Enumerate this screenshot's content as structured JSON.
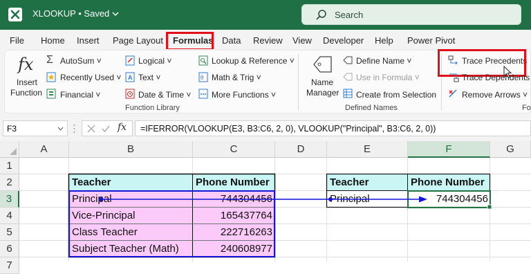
{
  "titlebar": {
    "doc_name": "XLOOKUP",
    "saved": "• Saved ",
    "search_placeholder": "Search"
  },
  "menu": {
    "file": "File",
    "home": "Home",
    "insert": "Insert",
    "page_layout": "Page Layout",
    "formulas": "Formulas",
    "data": "Data",
    "review": "Review",
    "view": "View",
    "developer": "Developer",
    "help": "Help",
    "power_pivot": "Power Pivot"
  },
  "ribbon": {
    "insert_function_l1": "Insert",
    "insert_function_l2": "Function",
    "autosum": "AutoSum ˅",
    "recently_used": "Recently Used ˅",
    "financial": "Financial ˅",
    "logical": "Logical ˅",
    "text": "Text ˅",
    "date_time": "Date & Time ˅",
    "lookup_ref": "Lookup & Reference ˅",
    "math_trig": "Math & Trig ˅",
    "more_functions": "More Functions ˅",
    "function_library": "Function Library",
    "name_manager_l1": "Name",
    "name_manager_l2": "Manager",
    "define_name": "Define Name ˅",
    "use_in_formula": "Use in Formula ˅",
    "create_from_selection": "Create from Selection",
    "defined_names": "Defined Names",
    "trace_precedents": "Trace Precedents",
    "trace_dependents": "Trace Dependents",
    "remove_arrows": "Remove Arrows ˅",
    "formula_auditing_partial": "Fo"
  },
  "formula_bar": {
    "name_box": "F3",
    "fx": "fx",
    "formula": "=IFERROR(VLOOKUP(E3, B3:C6, 2, 0), VLOOKUP(\"Principal\", B3:C6, 2, 0))"
  },
  "columns": [
    "A",
    "B",
    "C",
    "D",
    "E",
    "F",
    "G"
  ],
  "rows": [
    "1",
    "2",
    "3",
    "4",
    "5",
    "6",
    "7"
  ],
  "table1": {
    "headers": [
      "Teacher",
      "Phone Number"
    ],
    "rows": [
      [
        "Principal",
        "744304456"
      ],
      [
        "Vice-Principal",
        "165437764"
      ],
      [
        "Class Teacher",
        "222716263"
      ],
      [
        "Subject Teacher (Math)",
        "240608977"
      ]
    ]
  },
  "table2": {
    "headers": [
      "Teacher",
      "Phone Number"
    ],
    "lookup_value": "Principal",
    "result": "744304456"
  },
  "colors": {
    "excel_green": "#1f7145",
    "header_fill": "#c9f5f5",
    "data_fill": "#fbcaf8",
    "trace_arrow": "#1515d6",
    "highlight_red": "#e0101a"
  }
}
